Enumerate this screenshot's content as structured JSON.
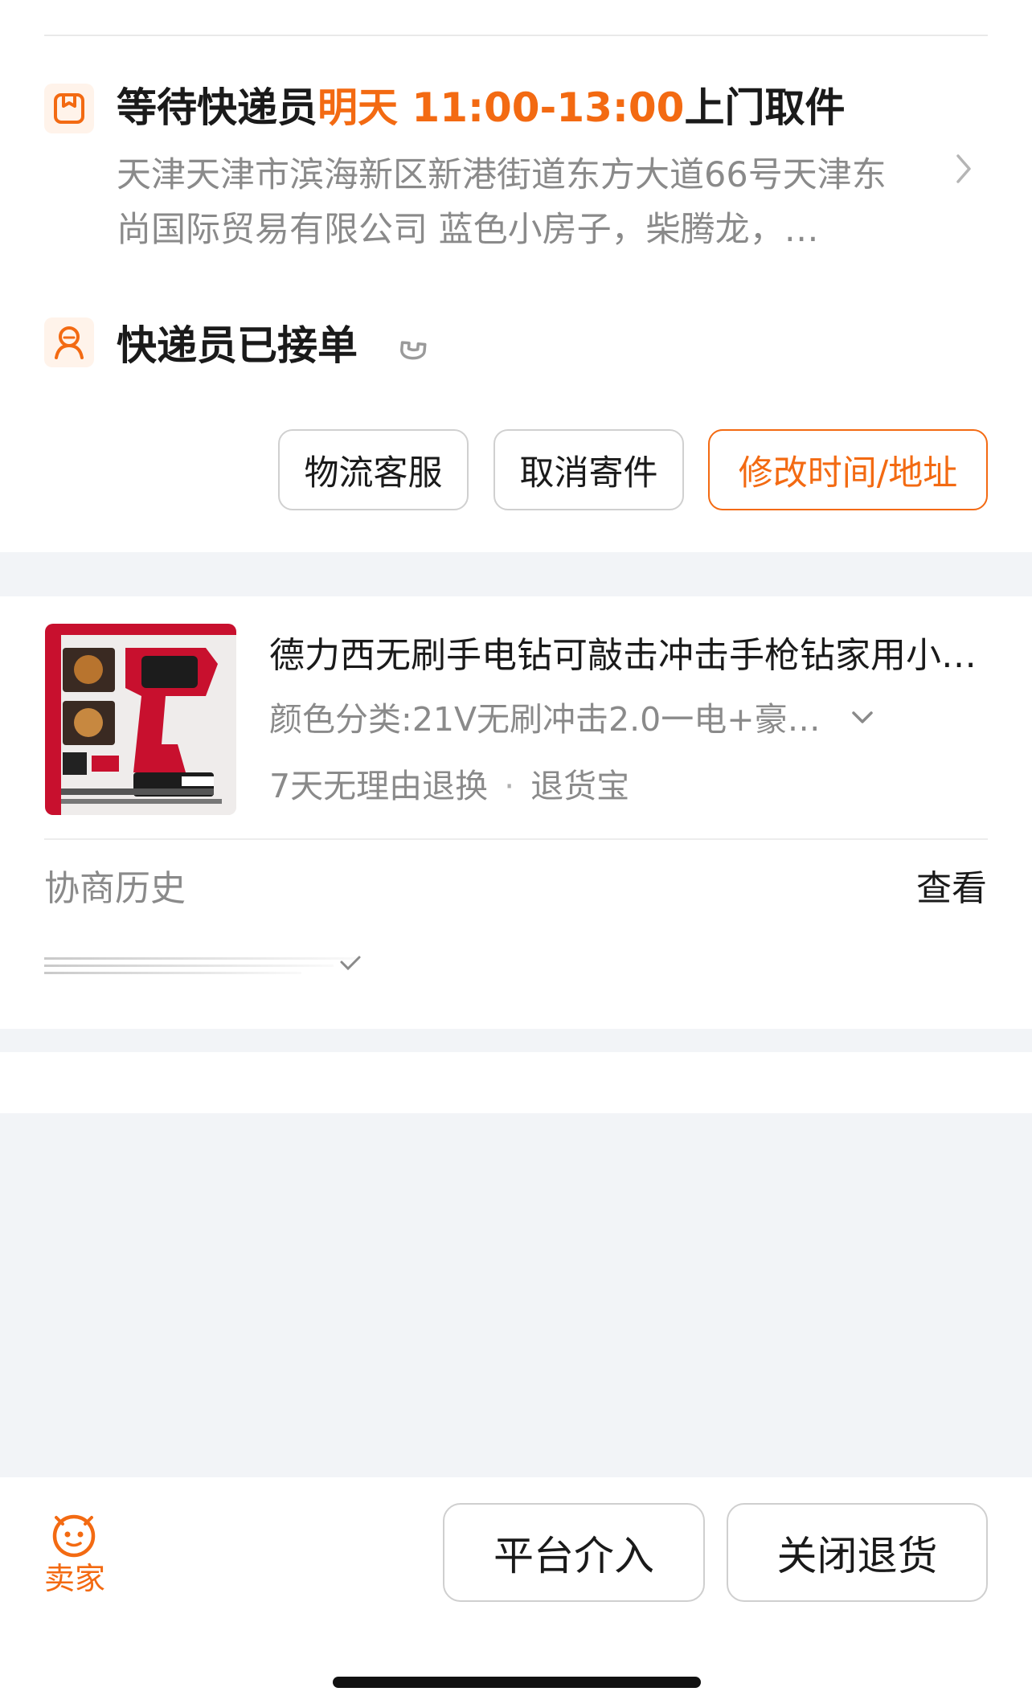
{
  "pickup": {
    "title_prefix": "等待快递员",
    "title_time": "明天 11:00-13:00",
    "title_suffix": "上门取件",
    "address": "天津天津市滨海新区新港街道东方大道66号天津东尚国际贸易有限公司 蓝色小房子，柴腾龙，…",
    "icon": "package-icon",
    "chevron": "chevron-right-icon"
  },
  "courier": {
    "status": "快递员已接单",
    "icon": "courier-icon",
    "phone_icon": "phone-icon"
  },
  "actions": {
    "logistics_service": "物流客服",
    "cancel_shipment": "取消寄件",
    "modify_time_address": "修改时间/地址"
  },
  "product": {
    "title": "德力西无刷手电钻可敲击冲击手枪钻家用小…",
    "spec": "颜色分类:21V无刷冲击2.0一电+豪…",
    "tag_return": "7天无理由退换",
    "tag_insurance": "退货宝",
    "thumbnail": "drill-product-image"
  },
  "history": {
    "label": "协商历史",
    "view": "查看"
  },
  "bottom": {
    "seller_label": "卖家",
    "platform_intervene": "平台介入",
    "close_return": "关闭退货"
  },
  "colors": {
    "accent": "#f36a12",
    "background": "#f2f4f7",
    "muted_text": "#8a8a8a"
  }
}
